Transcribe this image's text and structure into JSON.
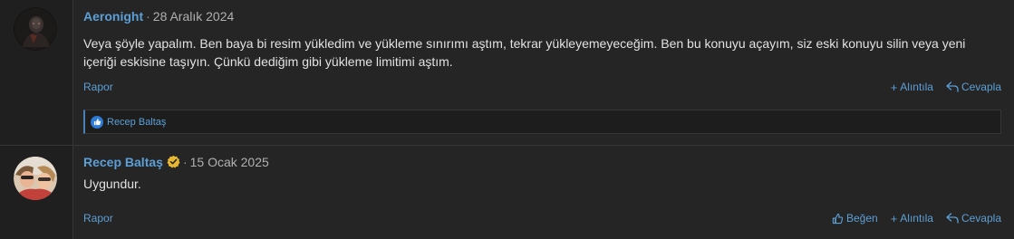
{
  "posts": [
    {
      "username": "Aeronight",
      "separator": "·",
      "date": "28 Aralık 2024",
      "message": "Veya şöyle yapalım. Ben baya bi resim yükledim ve yükleme sınırımı aştım, tekrar yükleyemeyeceğim. Ben bu konuyu açayım, siz eski konuyu silin veya yeni içeriği eskisine taşıyın. Çünkü dediğim gibi yükleme limitimi aştım.",
      "report_label": "Rapor",
      "quote_label": "Alıntıla",
      "reply_label": "Cevapla",
      "likes": [
        "Recep Baltaş"
      ]
    },
    {
      "username": "Recep Baltaş",
      "separator": "·",
      "date": "15 Ocak 2025",
      "message": "Uygundur.",
      "report_label": "Rapor",
      "like_label": "Beğen",
      "quote_label": "Alıntıla",
      "reply_label": "Cevapla"
    }
  ],
  "colors": {
    "link": "#5c9fd6",
    "background": "#252525",
    "verified_badge": "#e8b92f",
    "like_badge": "#2d7bd4"
  },
  "icons": {
    "avatar_1": "dark-figure-avatar",
    "avatar_2": "two-people-selfie-avatar",
    "verified": "verified-badge-icon",
    "like": "thumbs-up-icon",
    "quote": "plus-icon",
    "reply": "reply-arrow-icon"
  }
}
